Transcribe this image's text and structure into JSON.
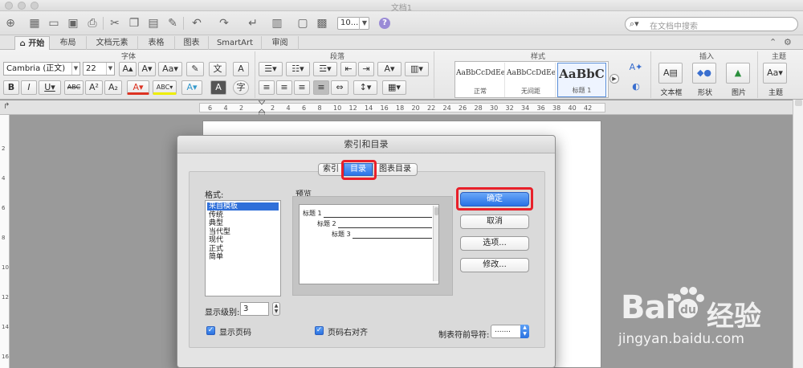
{
  "window": {
    "title": "文档1"
  },
  "toolbar": {
    "zoom_value": "10...",
    "search_placeholder": "在文档中搜索"
  },
  "ribbon_tabs": [
    "开始",
    "布局",
    "文档元素",
    "表格",
    "图表",
    "SmartArt",
    "审阅"
  ],
  "ribbon": {
    "groups": {
      "font": "字体",
      "paragraph": "段落",
      "styles": "样式",
      "insert": "插入",
      "themes": "主题"
    },
    "font_name": "Cambria (正文)",
    "font_size": "22",
    "styles_gallery": [
      {
        "sample": "AaBbCcDdEe",
        "name": "正常"
      },
      {
        "sample": "AaBbCcDdEe",
        "name": "无间距"
      },
      {
        "sample": "AaBbC",
        "name": "标题 1"
      }
    ],
    "insert_buttons": [
      "文本框",
      "形状",
      "图片"
    ],
    "themes_button": "主题"
  },
  "ruler": {
    "numbers": [
      "6",
      "4",
      "2",
      "",
      "2",
      "4",
      "6",
      "8",
      "10",
      "12",
      "14",
      "16",
      "18",
      "20",
      "22",
      "24",
      "26",
      "28",
      "30",
      "32",
      "34",
      "36",
      "38",
      "40",
      "42"
    ],
    "vertical_numbers": [
      "2",
      "4",
      "6",
      "8",
      "10",
      "12",
      "14",
      "16"
    ]
  },
  "dialog": {
    "title": "索引和目录",
    "tabs": [
      "索引",
      "目录",
      "图表目录"
    ],
    "active_tab": "目录",
    "format_label": "格式:",
    "formats": [
      "来自模板",
      "传统",
      "典型",
      "当代型",
      "现代",
      "正式",
      "简单"
    ],
    "selected_format": "来自模板",
    "preview_label": "预览",
    "preview_lines": [
      {
        "text": "标题 1",
        "page": "1"
      },
      {
        "text": "标题 2",
        "page": "1"
      },
      {
        "text": "标题 3",
        "page": "1"
      }
    ],
    "buttons": {
      "ok": "确定",
      "cancel": "取消",
      "options": "选项...",
      "modify": "修改..."
    },
    "levels_label": "显示级别:",
    "levels_value": "3",
    "show_page_numbers": "显示页码",
    "right_align_page_numbers": "页码右对齐",
    "tab_leader_label": "制表符前导符:",
    "tab_leader_value": "......."
  },
  "watermark": {
    "logo": "Bai",
    "logo_cn": "经验",
    "url": "jingyan.baidu.com"
  },
  "colors": {
    "highlight": "#e8202a",
    "accent": "#2a74e8"
  }
}
